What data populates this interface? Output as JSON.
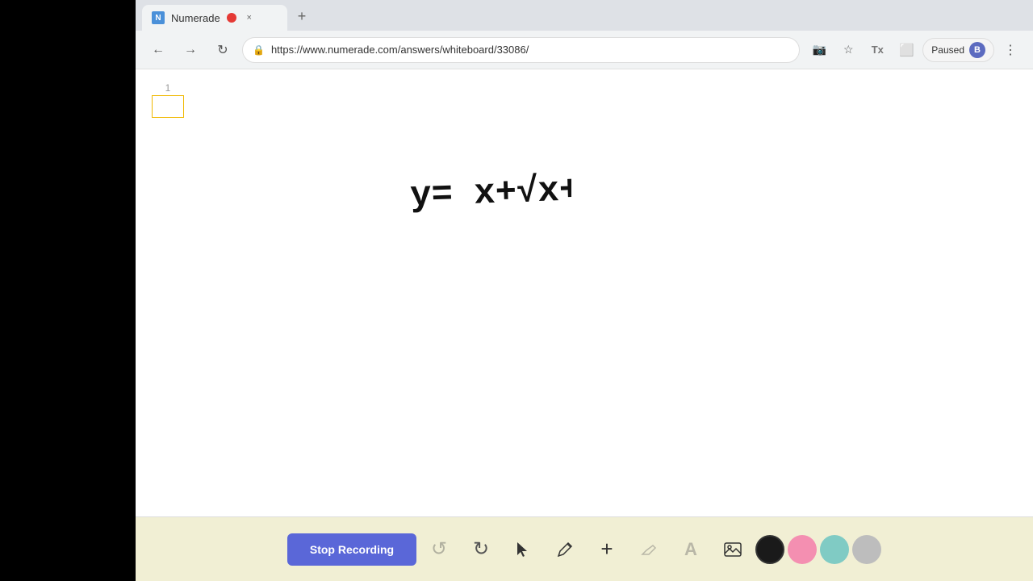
{
  "browser": {
    "tab": {
      "title": "Numerade",
      "favicon_label": "N",
      "close_label": "×"
    },
    "new_tab_label": "+",
    "nav": {
      "back_label": "←",
      "forward_label": "→",
      "reload_label": "↻",
      "url": "https://www.numerade.com/answers/whiteboard/33086/",
      "paused_label": "Paused",
      "avatar_label": "B",
      "menu_label": "⋮"
    }
  },
  "whiteboard": {
    "page_number": "1",
    "math_formula": "y= x+√x+c"
  },
  "toolbar": {
    "stop_recording_label": "Stop Recording",
    "undo_label": "↺",
    "redo_label": "↻",
    "cursor_label": "▶",
    "pen_label": "✏",
    "add_label": "+",
    "eraser_label": "◈",
    "text_label": "A",
    "image_label": "🖼",
    "colors": [
      "#1a1a1a",
      "#f48fb1",
      "#80cbc4",
      "#bdbdbd"
    ]
  }
}
